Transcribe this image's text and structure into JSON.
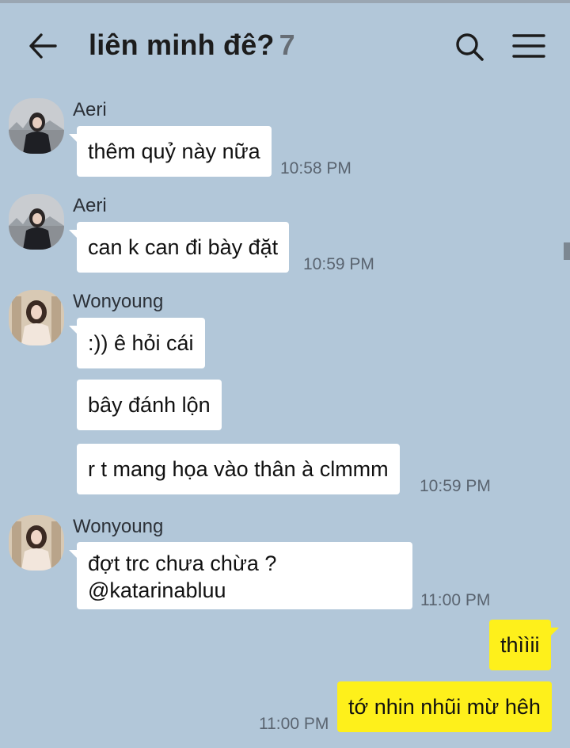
{
  "header": {
    "title": "liên minh đê?",
    "member_count": "7"
  },
  "icons": {
    "back": "arrow-left-icon",
    "search": "search-icon",
    "menu": "hamburger-menu-icon"
  },
  "colors": {
    "background": "#b2c7d9",
    "incoming_bubble": "#ffffff",
    "outgoing_bubble": "#fef01b"
  },
  "messages": {
    "m1": {
      "sender": "Aeri",
      "text": "thêm quỷ này nữa",
      "time": "10:58 PM"
    },
    "m2": {
      "sender": "Aeri",
      "text": "can k can đi bày đặt",
      "time": "10:59 PM"
    },
    "m3": {
      "sender": "Wonyoung",
      "lines": [
        ":)) ê hỏi cái",
        "bây đánh lộn",
        "r t mang họa vào thân à clmmm"
      ],
      "time": "10:59 PM"
    },
    "m4": {
      "sender": "Wonyoung",
      "line1": "đợt trc chưa chừa ?",
      "line2": "@katarinabluu",
      "time": "11:00 PM"
    },
    "m5": {
      "lines": [
        "thììii",
        "tớ nhin nhũi mừ hêh"
      ],
      "time": "11:00 PM"
    }
  }
}
